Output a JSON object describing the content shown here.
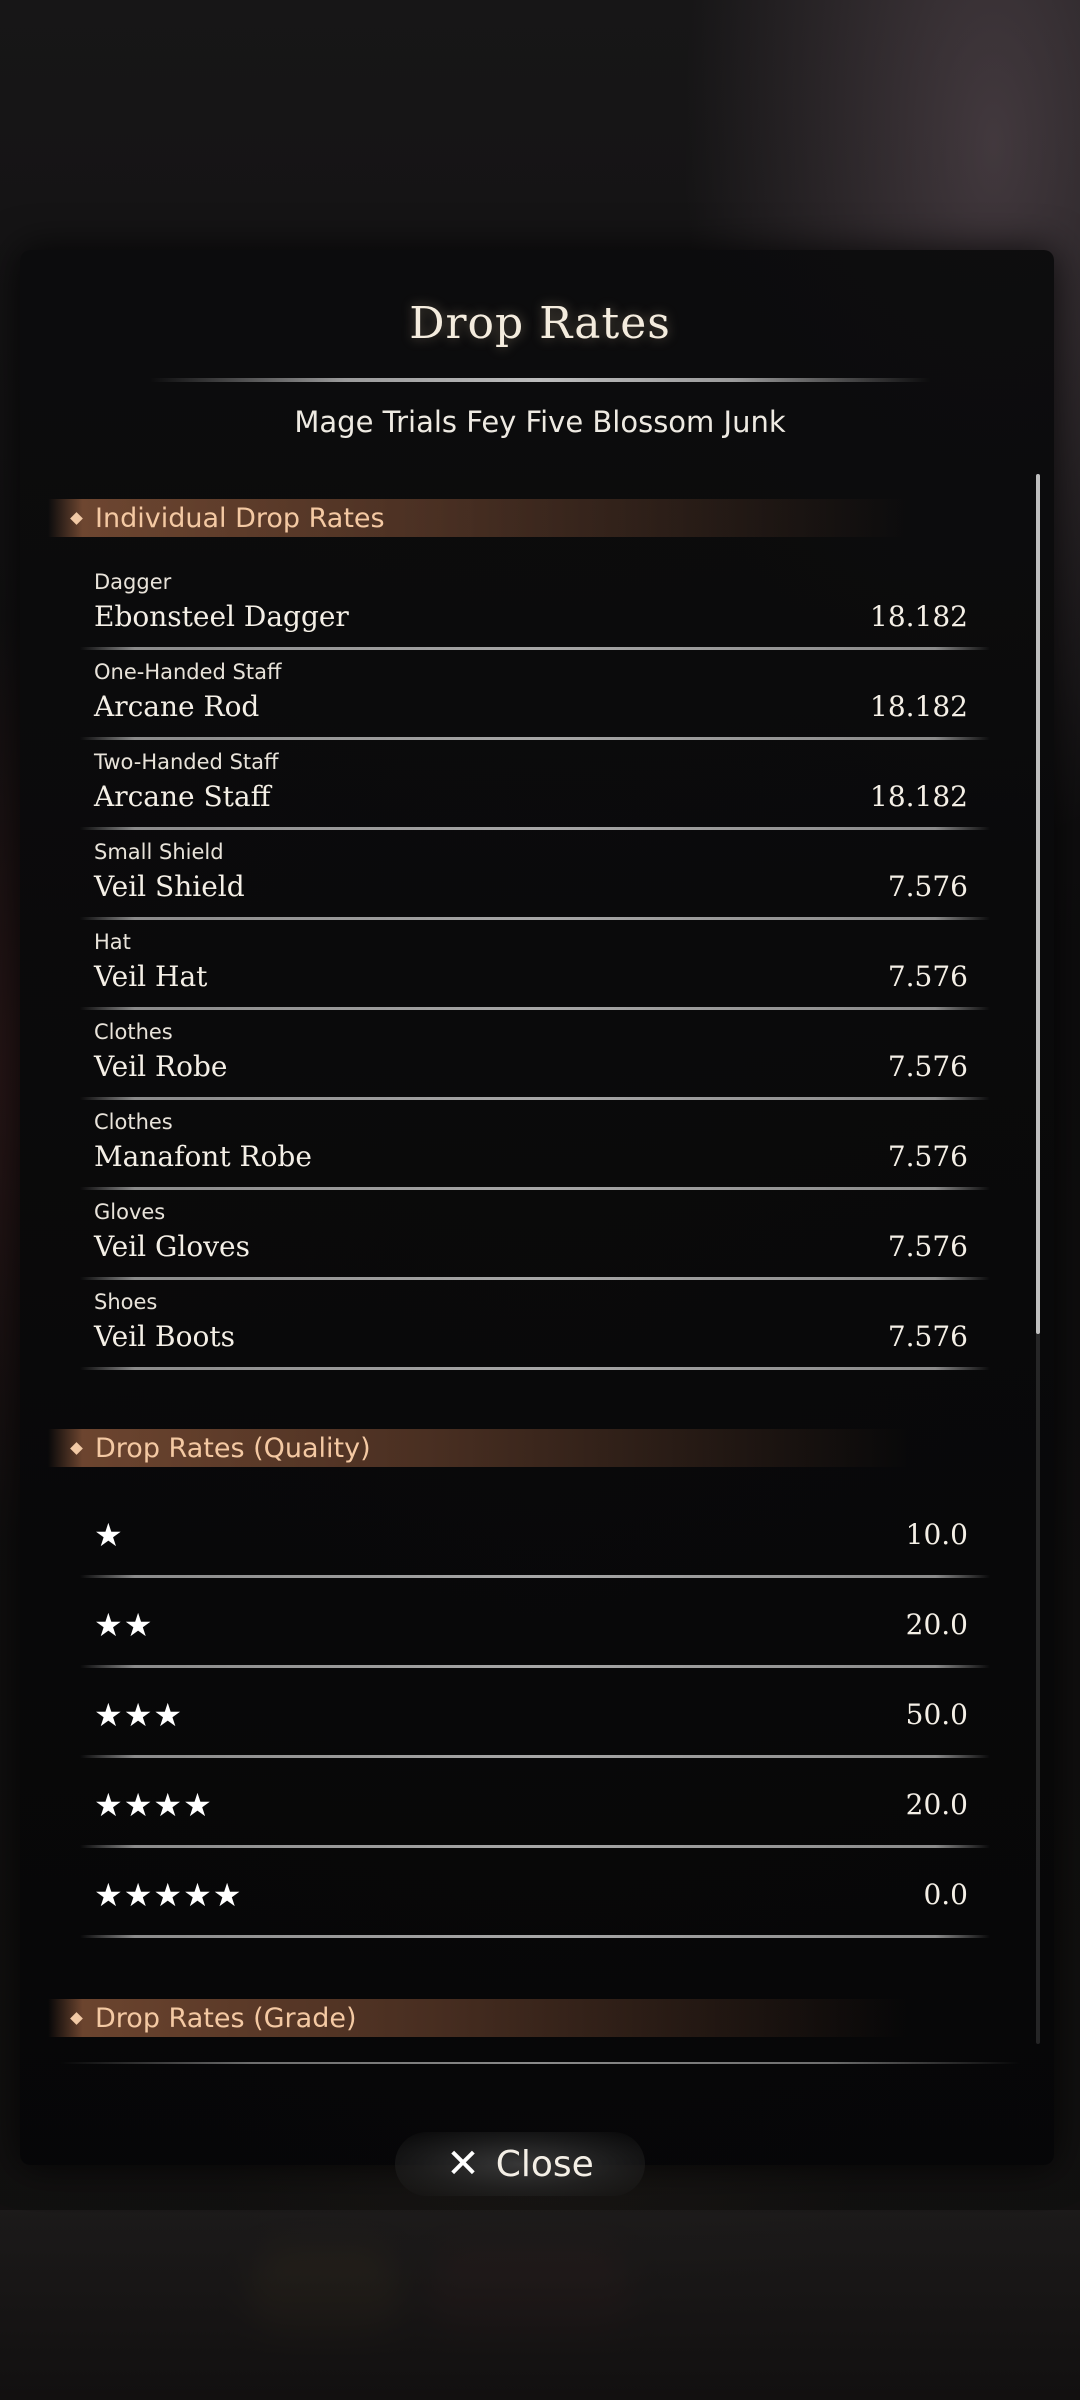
{
  "dialog": {
    "title": "Drop Rates",
    "subtitle": "Mage Trials Fey Five Blossom Junk"
  },
  "sections": {
    "individual": "Individual Drop Rates",
    "quality": "Drop Rates (Quality)",
    "grade": "Drop Rates (Grade)"
  },
  "individual_items": [
    {
      "type": "Dagger",
      "name": "Ebonsteel Dagger",
      "rate": "18.182"
    },
    {
      "type": "One-Handed Staff",
      "name": "Arcane Rod",
      "rate": "18.182"
    },
    {
      "type": "Two-Handed Staff",
      "name": "Arcane Staff",
      "rate": "18.182"
    },
    {
      "type": "Small Shield",
      "name": "Veil Shield",
      "rate": "7.576"
    },
    {
      "type": "Hat",
      "name": "Veil Hat",
      "rate": "7.576"
    },
    {
      "type": "Clothes",
      "name": "Veil Robe",
      "rate": "7.576"
    },
    {
      "type": "Clothes",
      "name": "Manafont Robe",
      "rate": "7.576"
    },
    {
      "type": "Gloves",
      "name": "Veil Gloves",
      "rate": "7.576"
    },
    {
      "type": "Shoes",
      "name": "Veil Boots",
      "rate": "7.576"
    }
  ],
  "quality_rates": [
    {
      "stars": "★",
      "rate": "10.0"
    },
    {
      "stars": "★★",
      "rate": "20.0"
    },
    {
      "stars": "★★★",
      "rate": "50.0"
    },
    {
      "stars": "★★★★",
      "rate": "20.0"
    },
    {
      "stars": "★★★★★",
      "rate": "0.0"
    }
  ],
  "close_button": {
    "icon": "close-icon",
    "label": "Close"
  },
  "colors": {
    "section_header": "#be764e",
    "section_text": "#f4c9a3",
    "text": "#f4efe6"
  }
}
